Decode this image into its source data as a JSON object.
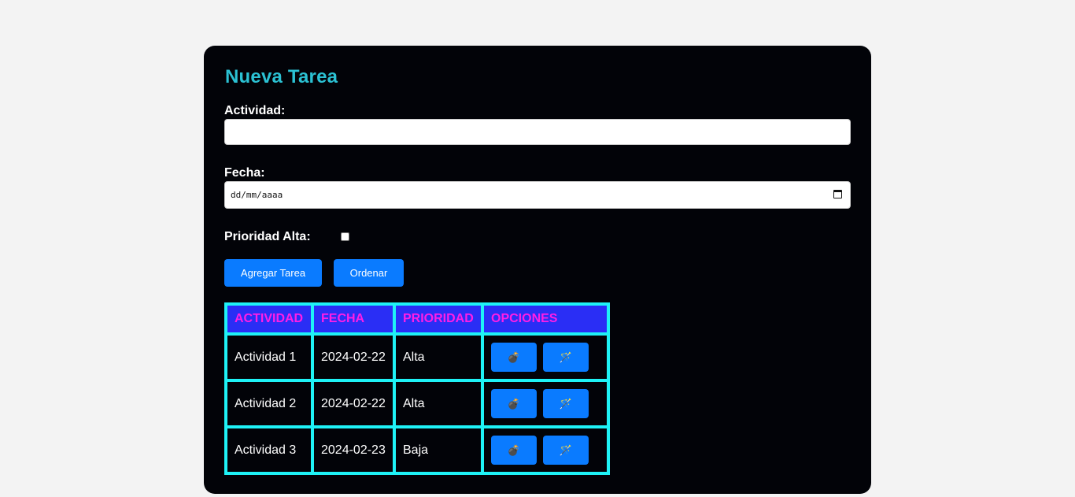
{
  "form": {
    "title": "Nueva Tarea",
    "activity_label": "Actividad:",
    "activity_value": "",
    "date_label": "Fecha:",
    "date_placeholder": "dd/mm/aaaa",
    "priority_label": "Prioridad Alta:",
    "priority_checked": false,
    "add_button": "Agregar Tarea",
    "sort_button": "Ordenar"
  },
  "table": {
    "headers": [
      "ACTIVIDAD",
      "FECHA",
      "PRIORIDAD",
      "OPCIONES"
    ],
    "rows": [
      {
        "actividad": "Actividad 1",
        "fecha": "2024-02-22",
        "prioridad": "Alta"
      },
      {
        "actividad": "Actividad 2",
        "fecha": "2024-02-22",
        "prioridad": "Alta"
      },
      {
        "actividad": "Actividad 3",
        "fecha": "2024-02-23",
        "prioridad": "Baja"
      }
    ],
    "row_actions": {
      "delete_icon": "💣",
      "edit_icon": "🪄"
    }
  },
  "colors": {
    "page_bg": "#f3f3f3",
    "panel_bg": "#020308",
    "title": "#2bc1d3",
    "button": "#0a7bff",
    "table_border": "#1ef2f6",
    "header_bg": "#2a2ef5",
    "header_text": "#ff1ee6"
  }
}
